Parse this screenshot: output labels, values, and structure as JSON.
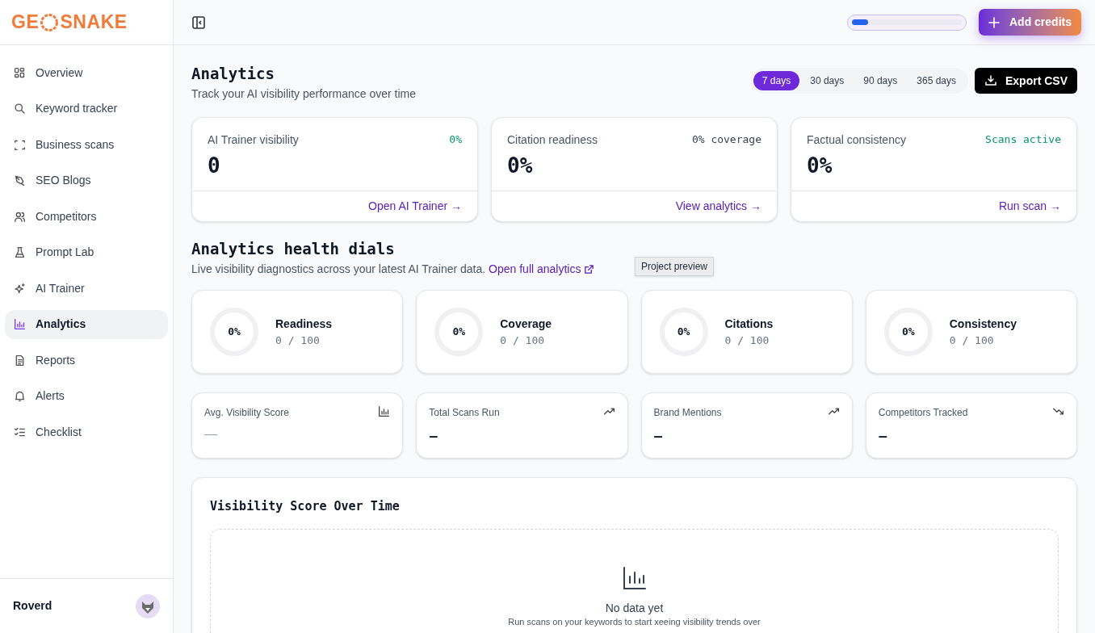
{
  "logo": {
    "left": "GE",
    "right": "SNAKE"
  },
  "sidebar": {
    "items": [
      {
        "label": "Overview",
        "selected": false
      },
      {
        "label": "Keyword tracker",
        "selected": false
      },
      {
        "label": "Business scans",
        "selected": false
      },
      {
        "label": "SEO Blogs",
        "selected": false
      },
      {
        "label": "Competitors",
        "selected": false
      },
      {
        "label": "Prompt Lab",
        "selected": false
      },
      {
        "label": "AI Trainer",
        "selected": false
      },
      {
        "label": "Analytics",
        "selected": true
      },
      {
        "label": "Reports",
        "selected": false
      },
      {
        "label": "Alerts",
        "selected": false
      },
      {
        "label": "Checklist",
        "selected": false
      }
    ],
    "user": {
      "name": "Roverd"
    }
  },
  "topbar": {
    "credits": {
      "level": 0.15
    },
    "add_button": "Add credits"
  },
  "header": {
    "title": "Analytics",
    "subtitle": "Track your AI visibility performance over time",
    "ranges": [
      {
        "label": "7 days",
        "selected": true
      },
      {
        "label": "30 days",
        "selected": false
      },
      {
        "label": "90 days",
        "selected": false
      },
      {
        "label": "365 days",
        "selected": false
      }
    ],
    "export_button": "Export CSV"
  },
  "summary_cards": [
    {
      "title": "AI Trainer visibility",
      "value": "0",
      "badge": "0%",
      "color": "#059669",
      "link": "Open AI Trainer →"
    },
    {
      "title": "Citation readiness",
      "value": "0%",
      "badge": "0% coverage",
      "color": "#374151",
      "link": "View analytics →"
    },
    {
      "title": "Factual consistency",
      "value": "0%",
      "badge": "Scans active",
      "color": "#059669",
      "link": "Run scan →"
    }
  ],
  "dials_section": {
    "title": "Analytics health dials",
    "description": "Live visibility diagnostics across your latest AI Trainer data.",
    "link": "Open full analytics",
    "tooltip": "Project preview",
    "dials": [
      {
        "value": "0%",
        "label": "Readiness",
        "score": "0 / 100"
      },
      {
        "value": "0%",
        "label": "Coverage",
        "score": "0 / 100"
      },
      {
        "value": "0%",
        "label": "Citations",
        "score": "0 / 100"
      },
      {
        "value": "0%",
        "label": "Consistency",
        "score": "0 / 100"
      }
    ]
  },
  "stats": [
    {
      "title": "Avg. Visibility Score",
      "value": "—",
      "kind": "bars",
      "muted": true
    },
    {
      "title": "Total Scans Run",
      "value": "–",
      "kind": "trend-up",
      "muted": false
    },
    {
      "title": "Brand Mentions",
      "value": "–",
      "kind": "trend-up",
      "muted": false
    },
    {
      "title": "Competitors Tracked",
      "value": "–",
      "kind": "trend-down",
      "muted": false
    }
  ],
  "chart_card": {
    "title": "Visibility Score Over Time",
    "empty_title": "No data yet",
    "empty_text": "Run scans on your keywords to start xeeing visibility trends over"
  }
}
